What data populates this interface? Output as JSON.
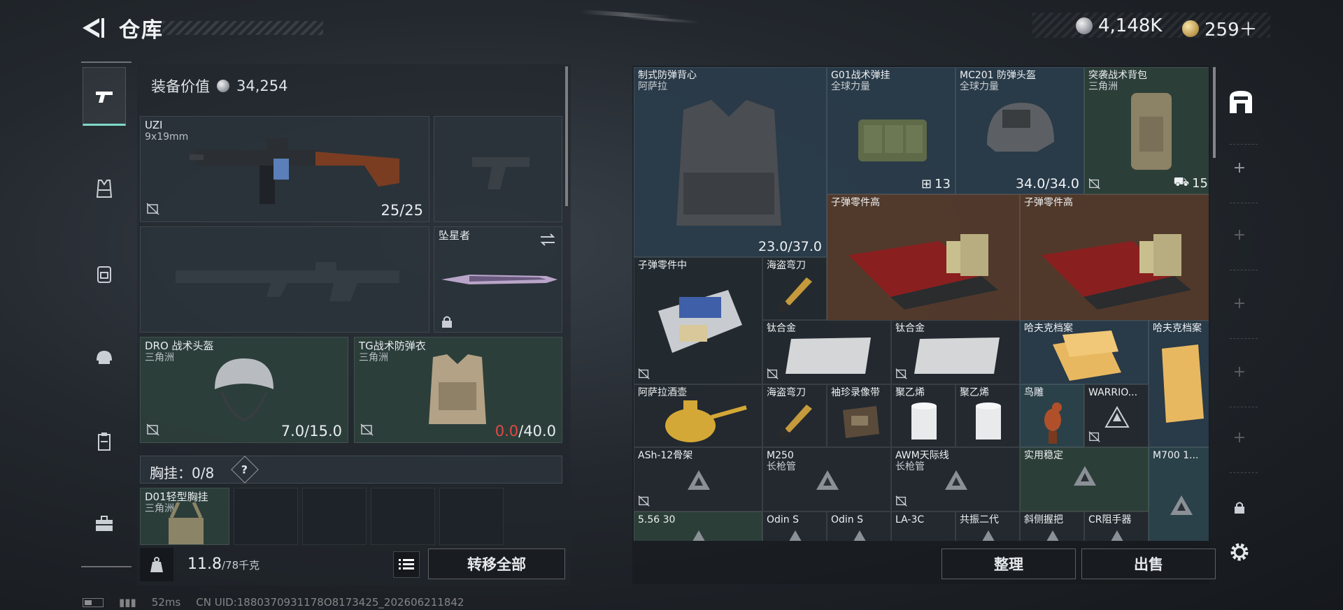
{
  "header": {
    "title": "仓库",
    "currency_silver": "4,148K",
    "currency_gold": "259＋"
  },
  "nav": {
    "items": [
      "pistol-icon",
      "vest-icon",
      "backpack-icon",
      "helmet-icon",
      "clipboard-icon",
      "toolbox-icon"
    ]
  },
  "equipment": {
    "value_label": "装备价值",
    "value_amount": "34,254",
    "primary": {
      "name": "UZI",
      "caliber": "9x19mm",
      "ammo": "25/25"
    },
    "melee": {
      "name": "坠星者"
    },
    "helmet": {
      "name": "DRO 战术头盔",
      "brand": "三角洲",
      "current": "7.0",
      "max": "/15.0"
    },
    "armor": {
      "name": "TG战术防弹衣",
      "brand": "三角洲",
      "current": "0.0",
      "max": "/40.0"
    },
    "chest": {
      "label": "胸挂：0/8",
      "help": "?"
    },
    "rig": {
      "name": "D01轻型胸挂",
      "brand": "三角洲"
    },
    "weight_current": "11.8",
    "weight_max": "/78千克",
    "transfer_all": "转移全部"
  },
  "storage": {
    "items": [
      {
        "name": "制式防弹背心",
        "sub": "阿萨拉",
        "dur": "23.0/37.0"
      },
      {
        "name": "G01战术弹挂",
        "sub": "全球力量",
        "count": "13"
      },
      {
        "name": "MC201 防弹头盔",
        "sub": "全球力量",
        "dur": "34.0/34.0"
      },
      {
        "name": "突袭战术背包",
        "sub": "三角洲",
        "count": "15"
      },
      {
        "name": "子弹零件高"
      },
      {
        "name": "子弹零件高"
      },
      {
        "name": "子弹零件中"
      },
      {
        "name": "海盗弯刀"
      },
      {
        "name": "钛合金"
      },
      {
        "name": "钛合金"
      },
      {
        "name": "哈夫克档案"
      },
      {
        "name": "哈夫克档案"
      },
      {
        "name": "阿萨拉酒壶"
      },
      {
        "name": "海盗弯刀"
      },
      {
        "name": "袖珍录像带"
      },
      {
        "name": "聚乙烯"
      },
      {
        "name": "聚乙烯"
      },
      {
        "name": "鸟雕"
      },
      {
        "name": "WARRIO..."
      },
      {
        "name": "ASh-12骨架"
      },
      {
        "name": "M250",
        "sub": "长枪管"
      },
      {
        "name": "AWM天际线",
        "sub": "长枪管"
      },
      {
        "name": "实用稳定"
      },
      {
        "name": "M700 1..."
      },
      {
        "name": "5.56 30"
      },
      {
        "name": "Odin S"
      },
      {
        "name": "Odin S"
      },
      {
        "name": "LA-3C"
      },
      {
        "name": "共振二代"
      },
      {
        "name": "斜侧握把"
      },
      {
        "name": "CR阻手器"
      }
    ],
    "sort_label": "整理",
    "sell_label": "出售"
  },
  "status": {
    "ping": "52ms",
    "uid": "CN UID:1880370931178O8173425_202606211842"
  },
  "colors": {
    "accent": "#7fd9c9",
    "danger": "#e24a45"
  }
}
